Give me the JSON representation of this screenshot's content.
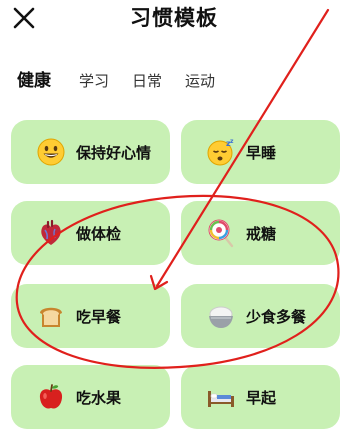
{
  "header": {
    "title": "习惯模板",
    "close_icon": "close-icon"
  },
  "tabs": [
    {
      "label": "健康",
      "active": true
    },
    {
      "label": "学习",
      "active": false
    },
    {
      "label": "日常",
      "active": false
    },
    {
      "label": "运动",
      "active": false
    }
  ],
  "templates": [
    {
      "label": "保持好心情",
      "icon": "smiley-icon"
    },
    {
      "label": "早睡",
      "icon": "sleepy-face-icon"
    },
    {
      "label": "做体检",
      "icon": "heart-organ-icon"
    },
    {
      "label": "戒糖",
      "icon": "lollipop-icon"
    },
    {
      "label": "吃早餐",
      "icon": "bread-icon"
    },
    {
      "label": "少食多餐",
      "icon": "rice-bowl-icon"
    },
    {
      "label": "吃水果",
      "icon": "apple-icon"
    },
    {
      "label": "早起",
      "icon": "bed-icon"
    }
  ],
  "colors": {
    "card_bg": "#c8f0b4",
    "annotation": "#e0201c",
    "text": "#111111"
  }
}
